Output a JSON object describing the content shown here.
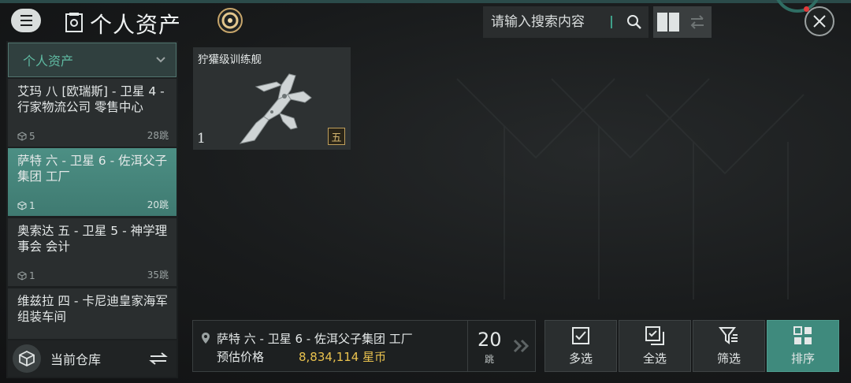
{
  "header": {
    "title": "个人资产",
    "search_placeholder": "请输入搜索内容"
  },
  "sidebar": {
    "dropdown_label": "个人资产",
    "locations": [
      {
        "name": "艾玛 八 [欧瑞斯] - 卫星 4 - 行家物流公司 零售中心",
        "count": "5",
        "jumps": "28跳",
        "selected": false
      },
      {
        "name": "萨特 六 - 卫星 6 - 佐洱父子集团 工厂",
        "count": "1",
        "jumps": "20跳",
        "selected": true
      },
      {
        "name": "奥索达 五 - 卫星 5 - 神学理事会 会计",
        "count": "1",
        "jumps": "35跳",
        "selected": false
      },
      {
        "name": "维兹拉 四 - 卡尼迪皇家海军 组装车间",
        "count": "",
        "jumps": "",
        "selected": false
      }
    ],
    "footer_label": "当前仓库"
  },
  "items": [
    {
      "name": "狞獾级训练舰",
      "quantity": "1",
      "tier": "五"
    }
  ],
  "info": {
    "location": "萨特 六 - 卫星 6 - 佐洱父子集团 工厂",
    "price_label": "预估价格",
    "price_value": "8,834,114 星币",
    "jumps": "20",
    "jumps_label": "跳"
  },
  "actions": {
    "multi_select": "多选",
    "select_all": "全选",
    "filter": "筛选",
    "sort": "排序"
  },
  "colors": {
    "accent": "#3f8a7d",
    "price": "#e9c24e",
    "tier": "#d2b46e"
  }
}
